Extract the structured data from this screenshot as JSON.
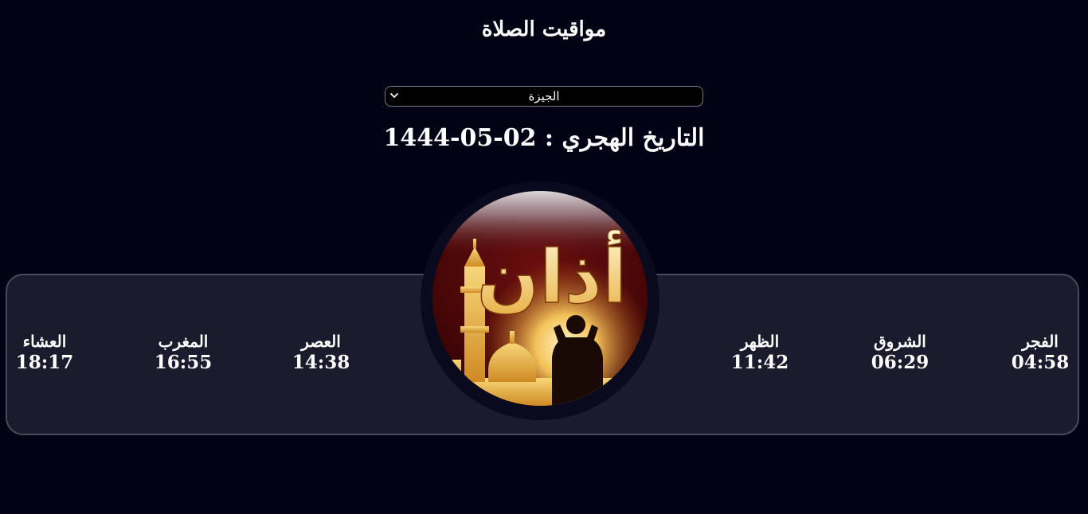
{
  "header": {
    "title": "مواقيت الصلاة"
  },
  "city_select": {
    "selected": "الجيزة"
  },
  "hijri": {
    "label": "التاريخ الهجري :",
    "value": "1444-05-02"
  },
  "logo": {
    "text": "أذان"
  },
  "prayers": [
    {
      "name": "الفجر",
      "time": "04:58"
    },
    {
      "name": "الشروق",
      "time": "06:29"
    },
    {
      "name": "الظهر",
      "time": "11:42"
    },
    {
      "name": "العصر",
      "time": "14:38"
    },
    {
      "name": "المغرب",
      "time": "16:55"
    },
    {
      "name": "العشاء",
      "time": "18:17"
    }
  ],
  "colors": {
    "background": "#020214",
    "panel": "#1b1b2d",
    "panel_border": "#4a4a5e",
    "text": "#ffffff",
    "gold": "#e8b046"
  }
}
